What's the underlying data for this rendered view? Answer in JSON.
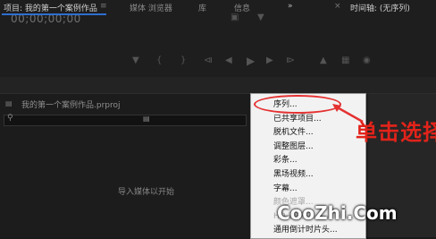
{
  "monitor": {
    "timecode": "00;00;00;00"
  },
  "tabs": [
    {
      "label": "项目: 我的第一个案例作品"
    },
    {
      "label": "媒体 浏览器"
    },
    {
      "label": "库"
    },
    {
      "label": "信息"
    }
  ],
  "timeline": {
    "title": "时间轴: (无序列)",
    "overflow": "»"
  },
  "project": {
    "file": "我的第一个案例作品.prproj",
    "empty_message": "导入媒体以开始"
  },
  "menu": {
    "items": [
      {
        "label": "序列...",
        "enabled": true
      },
      {
        "label": "已共享项目...",
        "enabled": true
      },
      {
        "label": "脱机文件...",
        "enabled": true
      },
      {
        "label": "调整图层...",
        "enabled": true
      },
      {
        "label": "彩条...",
        "enabled": true
      },
      {
        "label": "黑场视频...",
        "enabled": true
      },
      {
        "label": "字幕...",
        "enabled": true
      },
      {
        "label": "颜色遮罩...",
        "enabled": false
      },
      {
        "label": "HD 彩条...",
        "enabled": false
      },
      {
        "label": "通用倒计时片头...",
        "enabled": true
      }
    ]
  },
  "annotation": {
    "text": "单击选择"
  },
  "watermark": {
    "text": "CooZhi.Com"
  },
  "colors": {
    "annotation": "#e2231a",
    "tab_accent": "#2e6fd0"
  }
}
